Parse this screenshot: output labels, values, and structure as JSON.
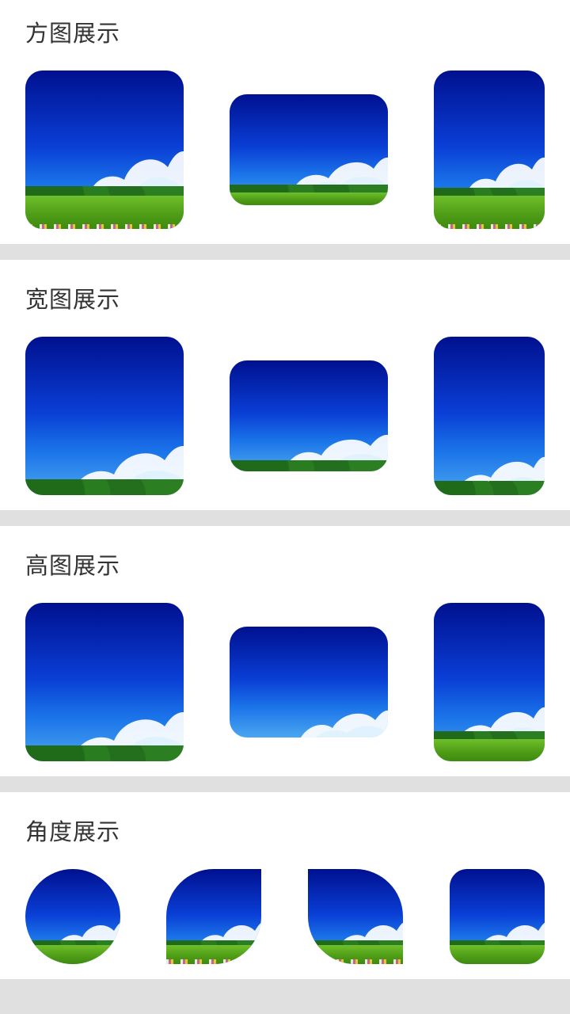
{
  "sections": [
    {
      "title": "方图展示"
    },
    {
      "title": "宽图展示"
    },
    {
      "title": "高图展示"
    },
    {
      "title": "角度展示"
    }
  ],
  "palette": {
    "page_bg": "#e0e0e0",
    "card_bg": "#ffffff",
    "title_color": "#333333",
    "sky_top": "#00108f",
    "sky_bottom": "#4aa6f0",
    "grass": "#5aa81f"
  },
  "image_icon": "landscape-sky-clouds-grass-photo"
}
